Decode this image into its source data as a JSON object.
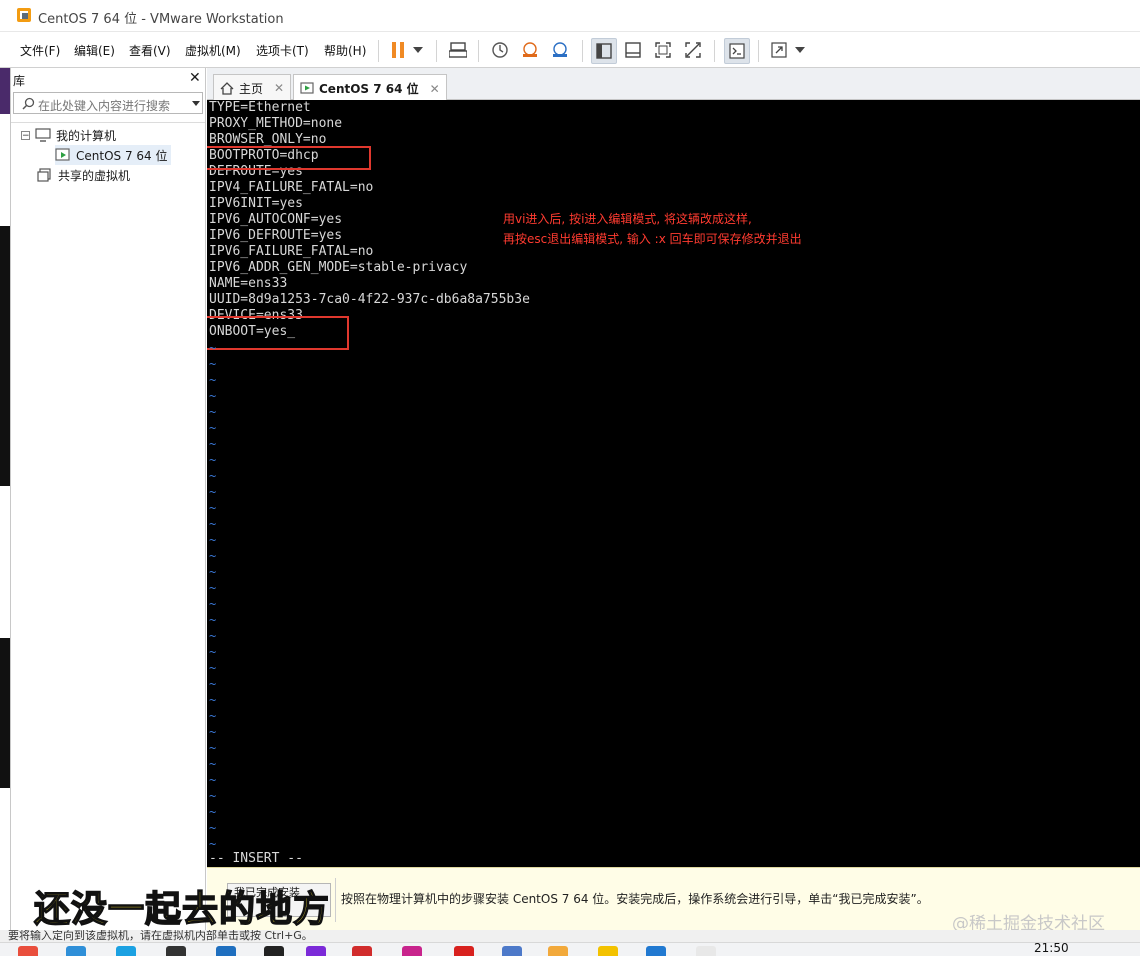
{
  "window": {
    "title": "CentOS 7 64 位 - VMware Workstation"
  },
  "menu": [
    "文件(F)",
    "编辑(E)",
    "查看(V)",
    "虚拟机(M)",
    "选项卡(T)",
    "帮助(H)"
  ],
  "library": {
    "title": "库",
    "search_placeholder": "在此处键入内容进行搜索",
    "tree": {
      "root": "我的计算机",
      "vm": "CentOS 7 64 位",
      "shared": "共享的虚拟机"
    }
  },
  "tabs": [
    {
      "label": "主页",
      "icon": "home-icon"
    },
    {
      "label": "CentOS 7 64 位",
      "icon": "vm-icon"
    }
  ],
  "terminal": {
    "lines": [
      "TYPE=Ethernet",
      "PROXY_METHOD=none",
      "BROWSER_ONLY=no",
      "BOOTPROTO=dhcp",
      "DEFROUTE=yes",
      "IPV4_FAILURE_FATAL=no",
      "IPV6INIT=yes",
      "IPV6_AUTOCONF=yes",
      "IPV6_DEFROUTE=yes",
      "IPV6_FAILURE_FATAL=no",
      "IPV6_ADDR_GEN_MODE=stable-privacy",
      "NAME=ens33",
      "UUID=8d9a1253-7ca0-4f22-937c-db6a8a755b3e",
      "DEVICE=ens33",
      "ONBOOT=yes_"
    ],
    "mode_line": "-- INSERT --",
    "tilde": "~"
  },
  "annotation": {
    "line1": "用vi进入后, 按i进入编辑模式, 将这辆改成这样,",
    "line2": "再按esc退出编辑模式, 输入 :x 回车即可保存修改并退出",
    "color": "#ff3b30"
  },
  "hint": {
    "button": "我已完成安装",
    "text": "按照在物理计算机中的步骤安装 CentOS 7 64 位。安装完成后，操作系统会进行引导，单击“我已完成安装”。"
  },
  "overlay": {
    "subtitle": "还没一起去的地方",
    "watermark": "@稀土掘金技术社区"
  },
  "statusbar": {
    "text": "要将输入定向到该虚拟机，请在虚拟机内部单击或按 Ctrl+G。"
  },
  "taskbar": {
    "clock": "21:50"
  }
}
